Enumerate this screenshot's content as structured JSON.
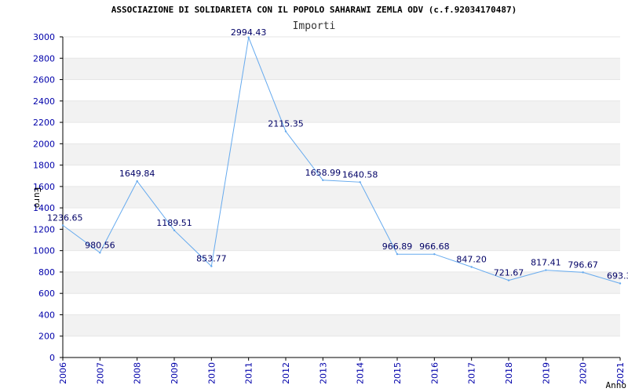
{
  "chart_data": {
    "type": "line",
    "title": "ASSOCIAZIONE DI SOLIDARIETA CON IL POPOLO SAHARAWI ZEMLA ODV (c.f.92034170487)",
    "subtitle": "Importi",
    "xlabel": "Anno",
    "ylabel": "Euro",
    "x": [
      "2006",
      "2007",
      "2008",
      "2009",
      "2010",
      "2011",
      "2012",
      "2013",
      "2014",
      "2015",
      "2016",
      "2017",
      "2018",
      "2019",
      "2020",
      "2021"
    ],
    "values": [
      1236.65,
      980.56,
      1649.84,
      1189.51,
      853.77,
      2994.43,
      2115.35,
      1658.99,
      1640.58,
      966.89,
      966.68,
      847.2,
      721.67,
      817.41,
      796.67,
      693.3
    ],
    "value_labels": [
      "1236.65",
      "980.56",
      "1649.84",
      "1189.51",
      "853.77",
      "2994.43",
      "2115.35",
      "1658.99",
      "1640.58",
      "966.89",
      "966.68",
      "847.20",
      "721.67",
      "817.41",
      "796.67",
      "693.3"
    ],
    "yticks": [
      "0",
      "200",
      "400",
      "600",
      "800",
      "1000",
      "1200",
      "1400",
      "1600",
      "1800",
      "2000",
      "2200",
      "2400",
      "2600",
      "2800",
      "3000"
    ],
    "ylim": [
      0,
      3000
    ],
    "grid": true,
    "colors": {
      "line": "#66aaee",
      "band": "#f2f2f2",
      "tick_text": "#0000aa",
      "value_text": "#000066"
    }
  }
}
